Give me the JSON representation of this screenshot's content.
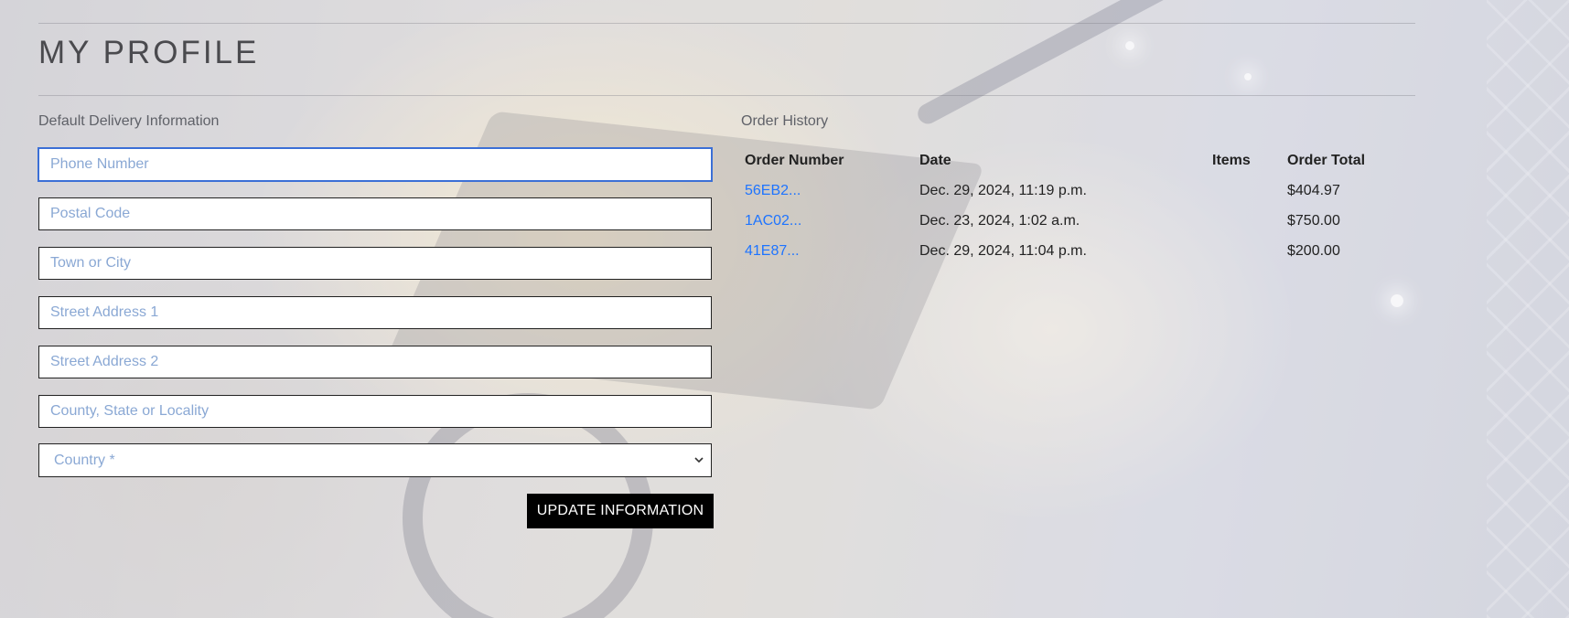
{
  "page": {
    "title": "MY PROFILE"
  },
  "delivery": {
    "section_label": "Default Delivery Information",
    "fields": [
      {
        "placeholder": "Phone Number",
        "value": ""
      },
      {
        "placeholder": "Postal Code",
        "value": ""
      },
      {
        "placeholder": "Town or City",
        "value": ""
      },
      {
        "placeholder": "Street Address 1",
        "value": ""
      },
      {
        "placeholder": "Street Address 2",
        "value": ""
      },
      {
        "placeholder": "County, State or Locality",
        "value": ""
      }
    ],
    "country_select": {
      "selected": "Country *",
      "icon": "chevron-down-icon"
    },
    "update_button": "UPDATE INFORMATION"
  },
  "orders": {
    "section_label": "Order History",
    "headers": [
      "Order Number",
      "Date",
      "Items",
      "Order Total"
    ],
    "rows": [
      {
        "number": "56EB2...",
        "date": "Dec. 29, 2024, 11:19 p.m.",
        "items": "",
        "total": "$404.97"
      },
      {
        "number": "1AC02...",
        "date": "Dec. 23, 2024, 1:02 a.m.",
        "items": "",
        "total": "$750.00"
      },
      {
        "number": "41E87...",
        "date": "Dec. 29, 2024, 11:04 p.m.",
        "items": "",
        "total": "$200.00"
      }
    ]
  },
  "colors": {
    "link": "#1e74ff",
    "placeholder": "#8aa8d4",
    "button_bg": "#000000",
    "focus_ring": "#3b6fd6"
  }
}
